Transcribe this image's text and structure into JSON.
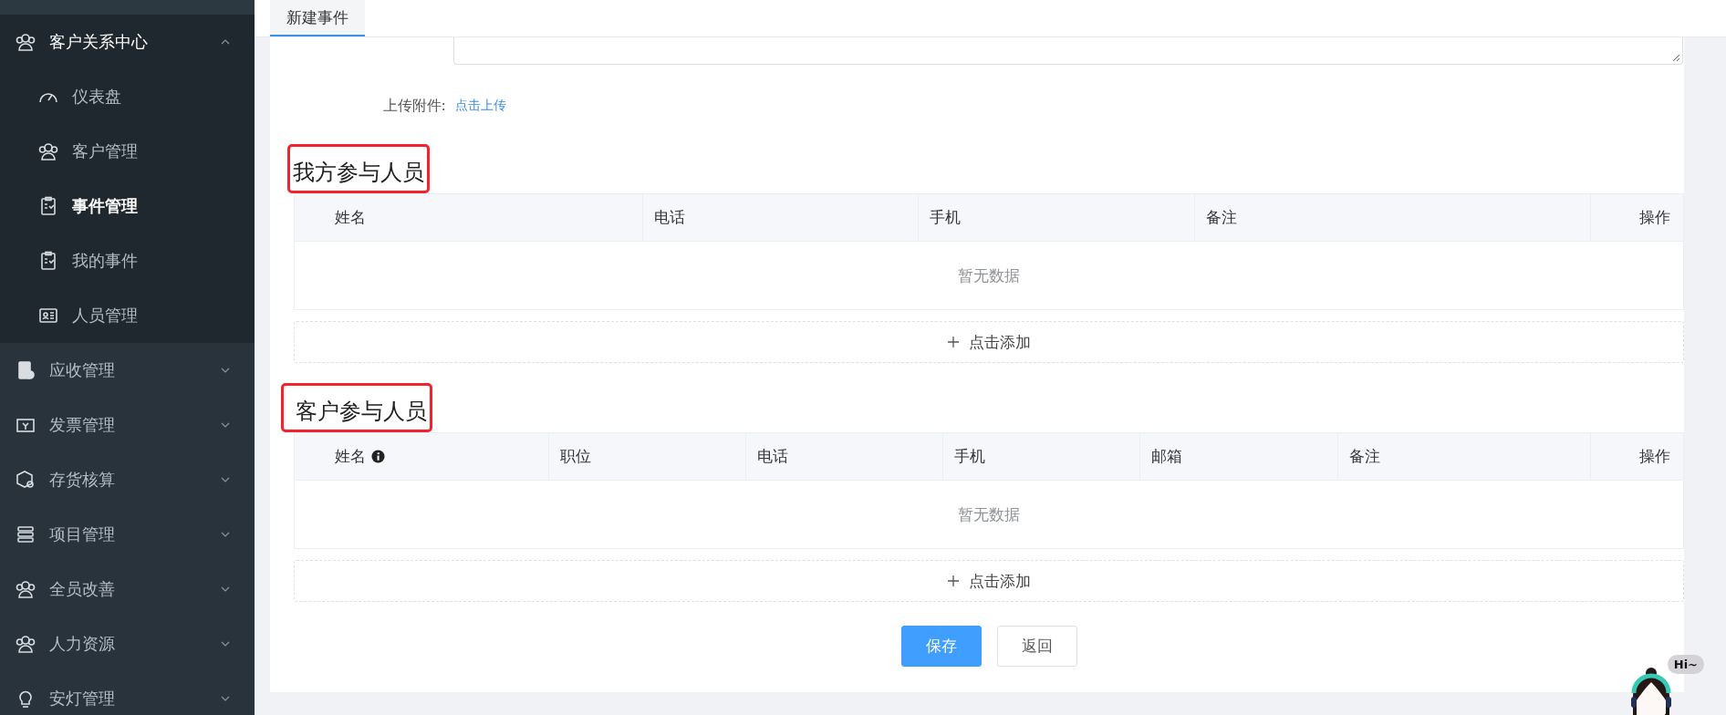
{
  "sidebar": {
    "items": [
      {
        "label": "客户关系中心",
        "expanded": true,
        "selected": false,
        "children": [
          {
            "label": "仪表盘",
            "selected": false
          },
          {
            "label": "客户管理",
            "selected": false
          },
          {
            "label": "事件管理",
            "selected": true
          },
          {
            "label": "我的事件",
            "selected": false
          },
          {
            "label": "人员管理",
            "selected": false
          }
        ]
      },
      {
        "label": "应收管理",
        "expanded": false,
        "selected": false
      },
      {
        "label": "发票管理",
        "expanded": false,
        "selected": false
      },
      {
        "label": "存货核算",
        "expanded": false,
        "selected": false
      },
      {
        "label": "项目管理",
        "expanded": false,
        "selected": false
      },
      {
        "label": "全员改善",
        "expanded": false,
        "selected": false
      },
      {
        "label": "人力资源",
        "expanded": false,
        "selected": false
      },
      {
        "label": "安灯管理",
        "expanded": false,
        "selected": false
      }
    ]
  },
  "tabs": [
    {
      "label": "新建事件",
      "selected": true
    }
  ],
  "form": {
    "attachment_label": "上传附件:",
    "upload_link": "点击上传"
  },
  "sections": [
    {
      "title": "我方参与人员",
      "columns": [
        {
          "label": "姓名",
          "info": false
        },
        {
          "label": "电话",
          "info": false
        },
        {
          "label": "手机",
          "info": false
        },
        {
          "label": "备注",
          "info": false
        },
        {
          "label": "操作",
          "info": false
        }
      ],
      "empty_text": "暂无数据",
      "add_label": "点击添加"
    },
    {
      "title": "客户参与人员",
      "columns": [
        {
          "label": "姓名",
          "info": true
        },
        {
          "label": "职位",
          "info": false
        },
        {
          "label": "电话",
          "info": false
        },
        {
          "label": "手机",
          "info": false
        },
        {
          "label": "邮箱",
          "info": false
        },
        {
          "label": "备注",
          "info": false
        },
        {
          "label": "操作",
          "info": false
        }
      ],
      "empty_text": "暂无数据",
      "add_label": "点击添加"
    }
  ],
  "buttons": [
    {
      "label": "保存",
      "kind": "primary"
    },
    {
      "label": "返回",
      "kind": "default"
    }
  ],
  "chat_widget": {
    "greeting": "Hi~"
  }
}
